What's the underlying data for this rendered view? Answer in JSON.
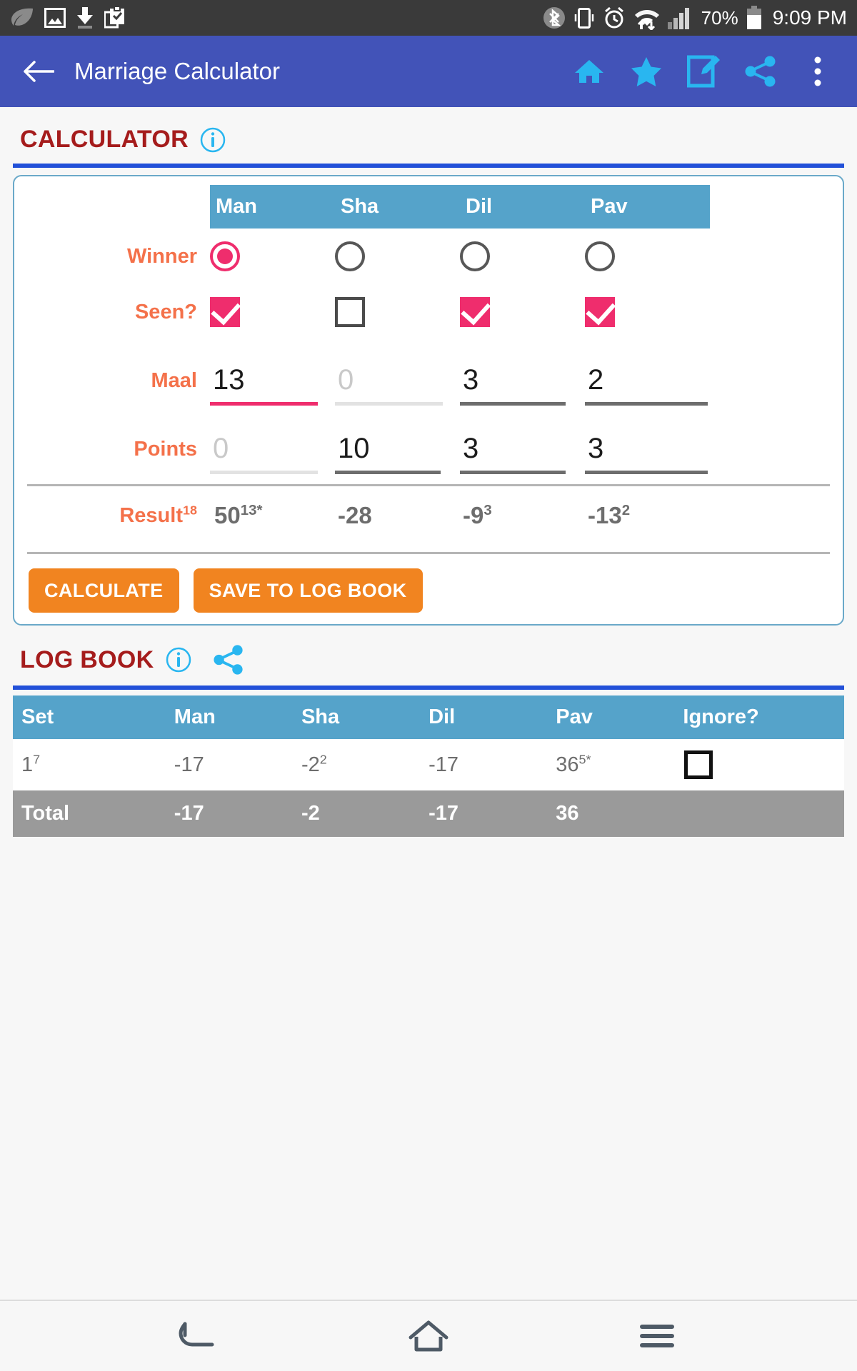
{
  "status_bar": {
    "time": "9:09 PM",
    "battery_percent": "70%",
    "left_icons": [
      "leaf-icon",
      "image-icon",
      "download-icon",
      "clipboard-check-icon"
    ],
    "right_icons": [
      "bluetooth-icon",
      "vibrate-icon",
      "alarm-icon",
      "wifi-data-icon",
      "signal-icon",
      "battery-icon"
    ],
    "background": "#3a3a3a"
  },
  "app_bar": {
    "title": "Marriage Calculator",
    "back_icon": "arrow-left-icon",
    "actions": [
      "home-icon",
      "star-icon",
      "edit-icon",
      "share-icon",
      "overflow-menu-icon"
    ],
    "background": "#4253b8",
    "icon_color": "#29b6f0"
  },
  "calculator": {
    "heading": "CALCULATOR",
    "info_icon": "info-icon",
    "columns": [
      "Man",
      "Sha",
      "Dil",
      "Pav"
    ],
    "rows": {
      "winner": {
        "label": "Winner",
        "values": [
          true,
          false,
          false,
          false
        ]
      },
      "seen": {
        "label": "Seen?",
        "values": [
          true,
          false,
          true,
          true
        ]
      },
      "maal": {
        "label": "Maal",
        "values": [
          "13",
          "",
          "3",
          "2"
        ],
        "placeholders": [
          "0",
          "0",
          "0",
          "0"
        ],
        "focused_index": 0
      },
      "points": {
        "label": "Points",
        "values": [
          "",
          "10",
          "3",
          "3"
        ],
        "placeholders": [
          "0",
          "0",
          "0",
          "0"
        ],
        "focused_index": -1
      },
      "result": {
        "label": "Result",
        "label_sup": "18",
        "values": [
          {
            "main": "50",
            "sup": "13*"
          },
          {
            "main": "-28",
            "sup": ""
          },
          {
            "main": "-9",
            "sup": "3"
          },
          {
            "main": "-13",
            "sup": "2"
          }
        ]
      }
    },
    "buttons": {
      "calculate": "CALCULATE",
      "save": "SAVE TO LOG BOOK"
    },
    "accent_color": "#ef2d6d",
    "label_color": "#f4714a",
    "header_color": "#55a3ca",
    "button_color": "#f18420"
  },
  "log_book": {
    "heading": "LOG BOOK",
    "info_icon": "info-icon",
    "share_icon": "share-icon",
    "columns": [
      "Set",
      "Man",
      "Sha",
      "Dil",
      "Pav",
      "Ignore?"
    ],
    "rows": [
      {
        "set": {
          "main": "1",
          "sup": "7"
        },
        "cells": [
          {
            "main": "-17",
            "sup": ""
          },
          {
            "main": "-2",
            "sup": "2"
          },
          {
            "main": "-17",
            "sup": ""
          },
          {
            "main": "36",
            "sup": "5*"
          }
        ],
        "ignore": false
      }
    ],
    "total": {
      "label": "Total",
      "cells": [
        "-17",
        "-2",
        "-17",
        "36"
      ]
    },
    "header_color": "#55a3ca",
    "total_row_color": "#9a9a9a"
  },
  "nav_bar": {
    "items": [
      "back-nav-icon",
      "home-nav-icon",
      "recents-nav-icon"
    ]
  }
}
